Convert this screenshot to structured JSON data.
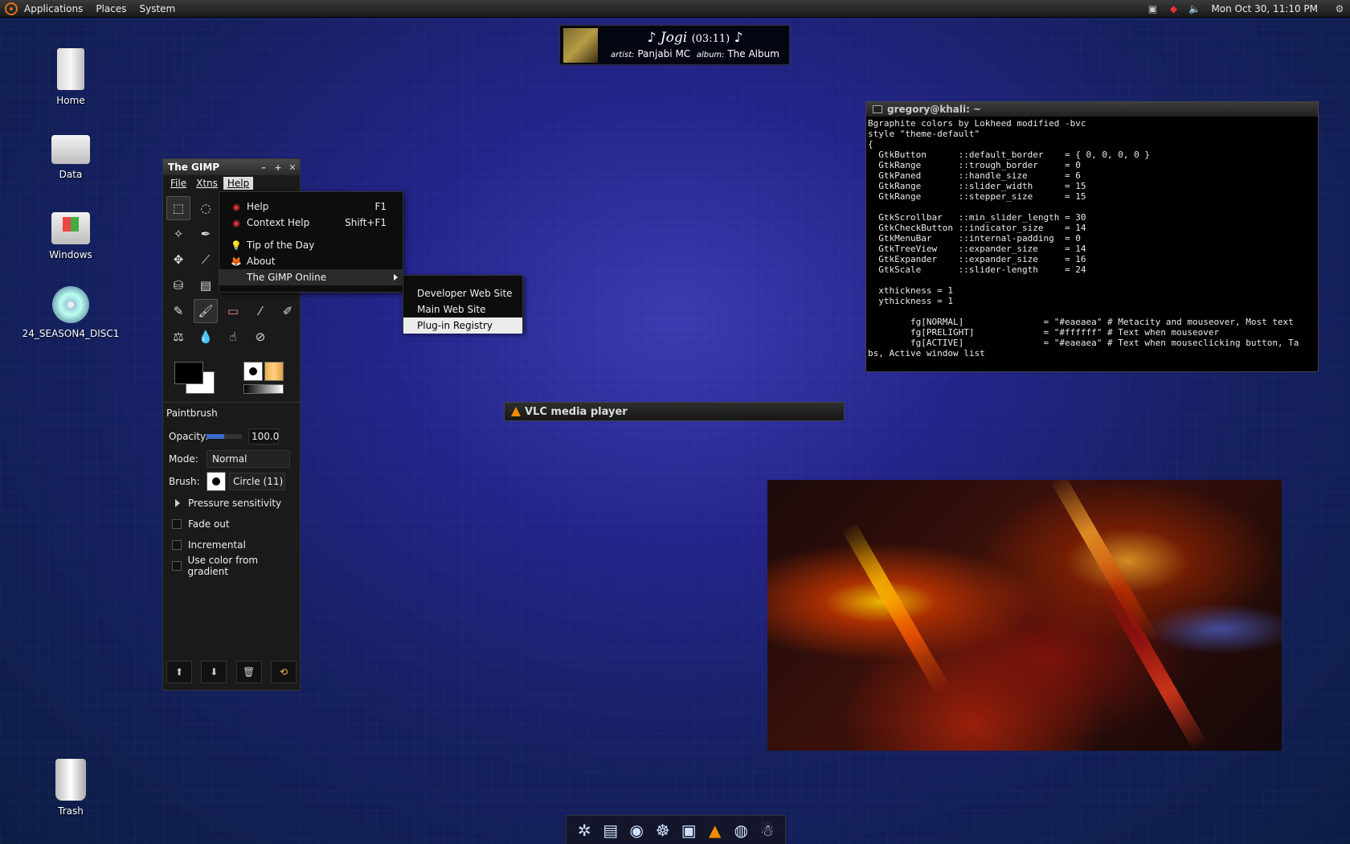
{
  "top_panel": {
    "menus": [
      "Applications",
      "Places",
      "System"
    ],
    "clock": "Mon Oct 30, 11:10 PM",
    "tray_icons": [
      "network-icon",
      "ruby-icon",
      "volume-icon"
    ]
  },
  "desktop_icons": [
    {
      "label": "Home",
      "icon": "home-folder-icon"
    },
    {
      "label": "Data",
      "icon": "drive-icon"
    },
    {
      "label": "Windows",
      "icon": "windows-drive-icon"
    },
    {
      "label": "24_SEASON4_DISC1",
      "icon": "dvd-icon"
    },
    {
      "label": "Trash",
      "icon": "trash-icon"
    }
  ],
  "now_playing": {
    "title": "Jogi",
    "duration": "(03:11)",
    "artist_label": "artist:",
    "artist": "Panjabi MC",
    "album_label": "album:",
    "album": "The Album"
  },
  "gimp": {
    "title": "The GIMP",
    "menus": [
      "File",
      "Xtns",
      "Help"
    ],
    "tool_options_title": "Paintbrush",
    "opacity_label": "Opacity:",
    "opacity_value": "100.0",
    "opacity_fraction": 0.5,
    "mode_label": "Mode:",
    "mode_value": "Normal",
    "brush_label": "Brush:",
    "brush_value": "Circle (11)",
    "pressure_label": "Pressure sensitivity",
    "checks": [
      "Fade out",
      "Incremental",
      "Use color from gradient"
    ]
  },
  "help_menu": {
    "items": [
      {
        "label": "Help",
        "shortcut": "F1",
        "icon": "help-icon"
      },
      {
        "label": "Context Help",
        "shortcut": "Shift+F1",
        "icon": "context-help-icon"
      },
      {
        "label": "Tip of the Day",
        "shortcut": "",
        "icon": "lightbulb-icon"
      },
      {
        "label": "About",
        "shortcut": "",
        "icon": "wilber-icon"
      },
      {
        "label": "The GIMP Online",
        "shortcut": "",
        "icon": ""
      }
    ]
  },
  "online_menu": {
    "items": [
      "Developer Web Site",
      "Main Web Site",
      "Plug-in Registry"
    ]
  },
  "terminal": {
    "title": "gregory@khali: ~",
    "content": "Bgraphite colors by Lokheed modified -bvc\nstyle \"theme-default\"\n{\n  GtkButton      ::default_border    = { 0, 0, 0, 0 }\n  GtkRange       ::trough_border     = 0\n  GtkPaned       ::handle_size       = 6\n  GtkRange       ::slider_width      = 15\n  GtkRange       ::stepper_size      = 15\n\n  GtkScrollbar   ::min_slider_length = 30\n  GtkCheckButton ::indicator_size    = 14\n  GtkMenuBar     ::internal-padding  = 0\n  GtkTreeView    ::expander_size     = 14\n  GtkExpander    ::expander_size     = 16\n  GtkScale       ::slider-length     = 24\n\n  xthickness = 1\n  ythickness = 1\n\n        fg[NORMAL]               = \"#eaeaea\" # Metacity and mouseover, Most text\n        fg[PRELIGHT]             = \"#ffffff\" # Text when mouseover\n        fg[ACTIVE]               = \"#eaeaea\" # Text when mouseclicking button, Ta\nbs, Active window list"
  },
  "vlc": {
    "title": "VLC media player"
  },
  "dock": {
    "icons": [
      "settings-icon",
      "document-icon",
      "firefox-icon",
      "gnome-foot-icon",
      "image-viewer-icon",
      "vlc-icon",
      "network-globe-icon",
      "pidgin-icon"
    ]
  },
  "colors": {
    "menu_bg": "#0d0d0d",
    "selection": "#ececec",
    "vlc_orange": "#f08a00"
  }
}
